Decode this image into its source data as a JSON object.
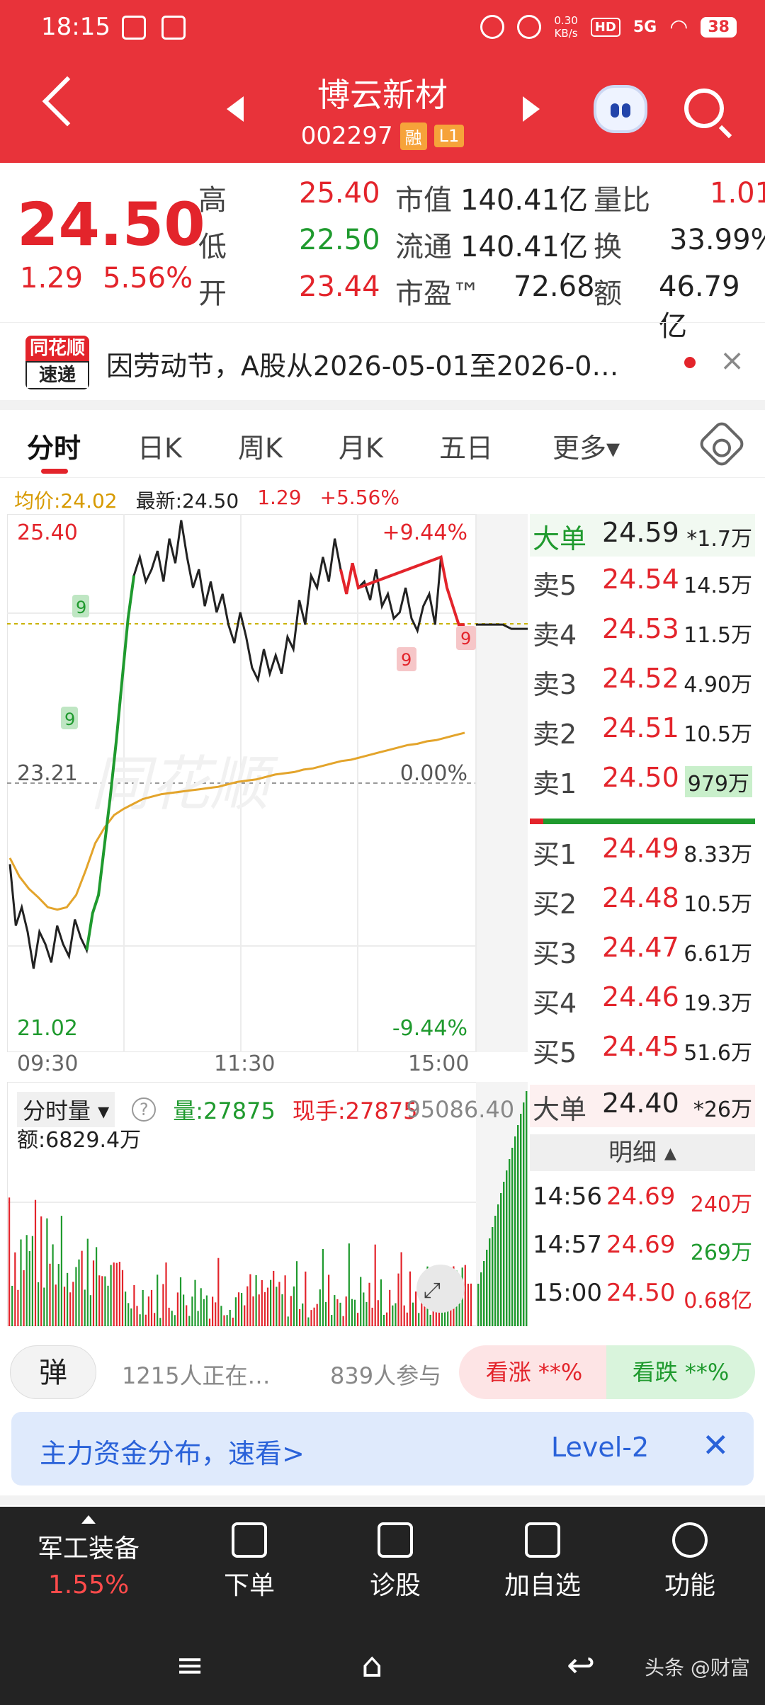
{
  "status": {
    "time": "18:15",
    "speed_top": "0.30",
    "speed_bottom": "KB/s",
    "hd": "HD",
    "signal": "5G",
    "battery": "38"
  },
  "header": {
    "name": "博云新材",
    "code": "002297",
    "tag1": "融",
    "tag2": "L1"
  },
  "quote": {
    "price": "24.50",
    "change": "1.29",
    "change_pct": "5.56%",
    "labels": {
      "high": "高",
      "low": "低",
      "open": "开",
      "mcap": "市值",
      "float": "流通",
      "pe": "市盈™",
      "vr": "量比",
      "turn": "换",
      "amt": "额"
    },
    "high": "25.40",
    "low": "22.50",
    "open": "23.44",
    "mcap": "140.41亿",
    "float": "140.41亿",
    "pe": "72.68",
    "vr": "1.01",
    "turn": "33.99%",
    "amt": "46.79亿"
  },
  "news": {
    "logo_top": "同花顺",
    "logo_bottom": "速递",
    "text": "因劳动节，A股从2026-05-01至2026-0…",
    "close": "×"
  },
  "tabs": [
    "分时",
    "日K",
    "周K",
    "月K",
    "五日",
    "更多▾"
  ],
  "chart_legend": {
    "avg": "均价:24.02",
    "latest": "最新:24.50",
    "chg": "1.29",
    "pct": "+5.56%"
  },
  "chart_data": {
    "type": "line",
    "title": "",
    "xlabel": "",
    "ylabel": "",
    "ylim": [
      21.02,
      25.4
    ],
    "y_top_label": "25.40",
    "y_mid_label": "23.21",
    "y_bot_label": "21.02",
    "pct_top": "+9.44%",
    "pct_mid": "0.00%",
    "pct_bot": "-9.44%",
    "x_ticks": [
      "09:30",
      "11:30",
      "15:00"
    ],
    "price": [
      22.55,
      22.05,
      22.2,
      22.0,
      21.7,
      22.0,
      21.9,
      21.75,
      22.05,
      21.9,
      21.8,
      22.1,
      21.95,
      21.85,
      22.15,
      22.3,
      22.7,
      23.1,
      23.55,
      24.05,
      24.55,
      24.9,
      25.05,
      24.85,
      24.95,
      25.1,
      24.85,
      25.2,
      25.0,
      25.35,
      25.05,
      24.8,
      24.95,
      24.65,
      24.85,
      24.6,
      24.75,
      24.5,
      24.35,
      24.6,
      24.4,
      24.15,
      24.05,
      24.3,
      24.1,
      24.25,
      24.1,
      24.4,
      24.3,
      24.7,
      24.5,
      24.9,
      24.8,
      25.05,
      24.85,
      25.2,
      24.95,
      24.75,
      25.0,
      24.8,
      24.85,
      24.7,
      24.95,
      24.65,
      24.75,
      24.55,
      24.6,
      24.8,
      24.55,
      24.45,
      24.65,
      24.75,
      24.5,
      25.05,
      24.8,
      24.65,
      24.5,
      24.5
    ],
    "avg": [
      22.6,
      22.45,
      22.35,
      22.28,
      22.2,
      22.18,
      22.2,
      22.3,
      22.5,
      22.72,
      22.85,
      22.95,
      23.0,
      23.04,
      23.08,
      23.1,
      23.12,
      23.13,
      23.14,
      23.15,
      23.16,
      23.17,
      23.18,
      23.2,
      23.22,
      23.23,
      23.24,
      23.26,
      23.28,
      23.29,
      23.3,
      23.32,
      23.33,
      23.35,
      23.37,
      23.39,
      23.4,
      23.42,
      23.44,
      23.46,
      23.48,
      23.5,
      23.52,
      23.53,
      23.55,
      23.56,
      23.58,
      23.6,
      23.62
    ],
    "after_hours": "24.50",
    "markers": [
      "9",
      "9",
      "9",
      "9"
    ]
  },
  "book": {
    "big_top": {
      "label": "大单",
      "price": "24.59",
      "vol": "*1.7万"
    },
    "asks": [
      {
        "label": "卖5",
        "price": "24.54",
        "vol": "14.5万"
      },
      {
        "label": "卖4",
        "price": "24.53",
        "vol": "11.5万"
      },
      {
        "label": "卖3",
        "price": "24.52",
        "vol": "4.90万"
      },
      {
        "label": "卖2",
        "price": "24.51",
        "vol": "10.5万"
      },
      {
        "label": "卖1",
        "price": "24.50",
        "vol": "979万"
      }
    ],
    "bids": [
      {
        "label": "买1",
        "price": "24.49",
        "vol": "8.33万"
      },
      {
        "label": "买2",
        "price": "24.48",
        "vol": "10.5万"
      },
      {
        "label": "买3",
        "price": "24.47",
        "vol": "6.61万"
      },
      {
        "label": "买4",
        "price": "24.46",
        "vol": "19.3万"
      },
      {
        "label": "买5",
        "price": "24.45",
        "vol": "51.6万"
      }
    ],
    "big_bottom": {
      "label": "大单",
      "price": "24.40",
      "vol": "*26万"
    },
    "detail_title": "明细 ▴",
    "ticks": [
      {
        "t": "14:56",
        "p": "24.69",
        "v": "240万"
      },
      {
        "t": "14:57",
        "p": "24.69",
        "v": "269万"
      },
      {
        "t": "15:00",
        "p": "24.50",
        "v": "0.68亿"
      }
    ]
  },
  "volume": {
    "title": "分时量 ▾",
    "help": "?",
    "vol": "量:27875",
    "cur": "现手:27875",
    "max": "95086.40",
    "amt": "额:6829.4万"
  },
  "social": {
    "bomb": "弹",
    "watching": "1215人正在…",
    "joined": "839人参与",
    "bull": "看涨 **%",
    "bear": "看跌 **%"
  },
  "banner": {
    "text": "主力资金分布，速看>",
    "level2": "Level-2",
    "close": "✕"
  },
  "nav": {
    "sector": "军工装备",
    "sector_pct": "1.55%",
    "items": [
      "下单",
      "诊股",
      "加自选",
      "功能"
    ]
  },
  "sysnav": {
    "menu": "≡",
    "home": "⌂",
    "back": "↩",
    "watermark": "头条 @财富"
  },
  "colors": {
    "red": "#e3242b",
    "green": "#1f9a2e",
    "header": "#e8333a"
  }
}
